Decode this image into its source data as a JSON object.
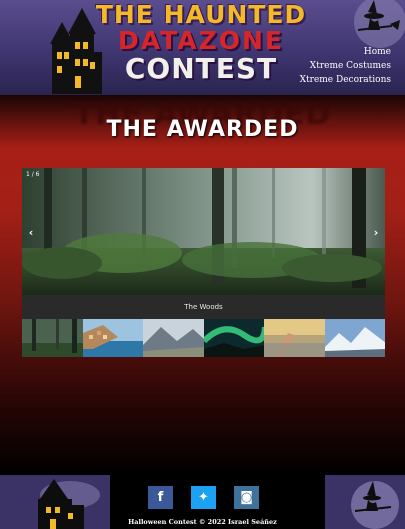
{
  "header": {
    "logo_line1": "THE HAUNTED",
    "logo_line2": "DATAZONE",
    "logo_line3": "CONTEST",
    "nav": [
      {
        "label": "Home"
      },
      {
        "label": "Xtreme Costumes"
      },
      {
        "label": "Xtreme Decorations"
      }
    ]
  },
  "main": {
    "title": "THE AWARDED",
    "gallery": {
      "counter": "1 / 6",
      "prev_icon": "chevron-left-icon",
      "next_icon": "chevron-right-icon",
      "caption": "The Woods",
      "thumbnails": [
        {
          "name": "forest"
        },
        {
          "name": "coastal-village"
        },
        {
          "name": "mountain-valley"
        },
        {
          "name": "aurora"
        },
        {
          "name": "hand-sunset"
        },
        {
          "name": "snowy-mountains"
        }
      ]
    }
  },
  "footer": {
    "socials": [
      {
        "icon": "facebook-icon",
        "glyph": "f"
      },
      {
        "icon": "twitter-icon",
        "glyph": "✦"
      },
      {
        "icon": "instagram-icon",
        "glyph": "◙"
      }
    ],
    "copyright": "Halloween Contest © 2022 Israel Seáñez"
  },
  "colors": {
    "accent_red": "#a81f17",
    "logo_yellow": "#f4b927",
    "logo_red": "#d8252a",
    "header_purple": "#4a3f7e"
  }
}
